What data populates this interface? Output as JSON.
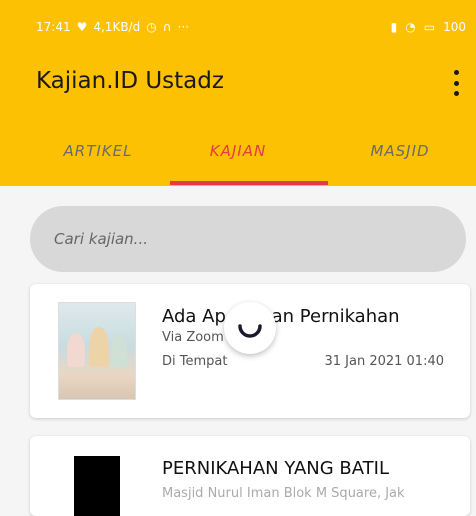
{
  "status_bar": {
    "time": "17:41",
    "speed": "4,1KB/d",
    "more": "···",
    "battery": "100"
  },
  "appbar": {
    "title": "Kajian.ID Ustadz"
  },
  "tabs": [
    {
      "label": "ARTIKEL"
    },
    {
      "label": "KAJIAN",
      "active": true
    },
    {
      "label": "MASJID"
    }
  ],
  "search": {
    "placeholder": "Cari kajian..."
  },
  "cards": [
    {
      "title": "Ada Ap... ngan Pernikahan",
      "via": "Via Zoom",
      "location": "Di Tempat",
      "date": "31 Jan 2021 01:40"
    },
    {
      "title": "PERNIKAHAN YANG BATIL",
      "via": "Masjid Nurul Iman Blok M Square, Jak"
    }
  ],
  "colors": {
    "appbar": "#fcc102",
    "accent": "#e53945"
  }
}
